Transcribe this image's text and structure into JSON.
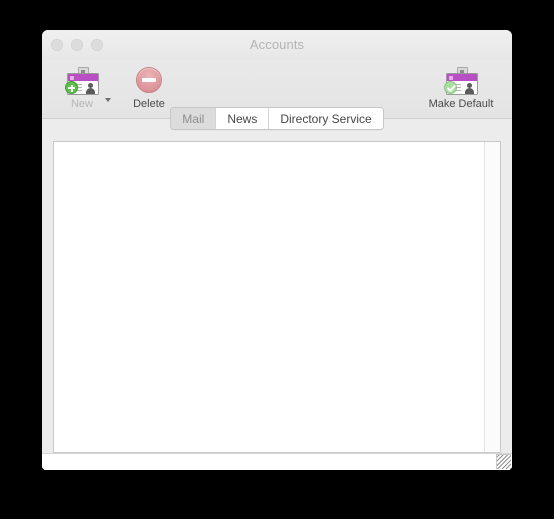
{
  "window": {
    "title": "Accounts",
    "traffic_lights": [
      {
        "name": "close",
        "color": "#dcdcdc"
      },
      {
        "name": "minimize",
        "color": "#dcdcdc"
      },
      {
        "name": "zoom",
        "color": "#dcdcdc"
      }
    ]
  },
  "toolbar": {
    "items": [
      {
        "label": "New",
        "icon": "new-account-card-icon",
        "enabled": false,
        "has_dropdown": true
      },
      {
        "label": "Delete",
        "icon": "delete-minus-circle-icon",
        "enabled": true,
        "has_dropdown": false
      },
      {
        "label": "Make Default",
        "icon": "make-default-card-check-icon",
        "enabled": true,
        "has_dropdown": false
      }
    ]
  },
  "tabs": {
    "selected": "Mail",
    "items": [
      {
        "label": "Mail"
      },
      {
        "label": "News"
      },
      {
        "label": "Directory Service"
      }
    ]
  },
  "content": {
    "accounts": [],
    "empty_text": ""
  },
  "colors": {
    "window_background": "#ececec",
    "titlebar": "#eeeeee",
    "toolbar": "#e6e6e6",
    "title_text": "#b4b4b7",
    "tab_selected_background": "#dcdcdc",
    "tab_selected_text": "#8e8e8e",
    "tab_text": "#474747",
    "card_band_purple": "#b94fc4",
    "badge_green": "#5cc24b",
    "delete_red": "#dd9399",
    "content_background": "#ffffff",
    "content_border": "#c8c8c8"
  }
}
